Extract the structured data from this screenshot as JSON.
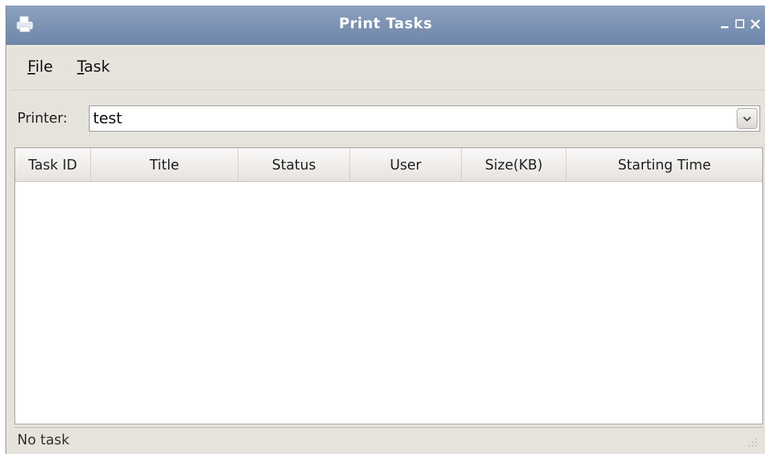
{
  "window": {
    "title": "Print Tasks",
    "icon": "printer-icon",
    "controls": [
      "minimize-icon",
      "maximize-icon",
      "close-icon"
    ],
    "titlebar_color": "#7d93b4"
  },
  "menubar": {
    "items": [
      {
        "label": "File",
        "mnemonic": "F",
        "rest": "ile"
      },
      {
        "label": "Task",
        "mnemonic": "T",
        "rest": "ask"
      }
    ]
  },
  "printer": {
    "label": "Printer:",
    "value": "test"
  },
  "table": {
    "columns": [
      "Task ID",
      "Title",
      "Status",
      "User",
      "Size(KB)",
      "Starting Time"
    ],
    "rows": []
  },
  "statusbar": {
    "text": "No task"
  }
}
